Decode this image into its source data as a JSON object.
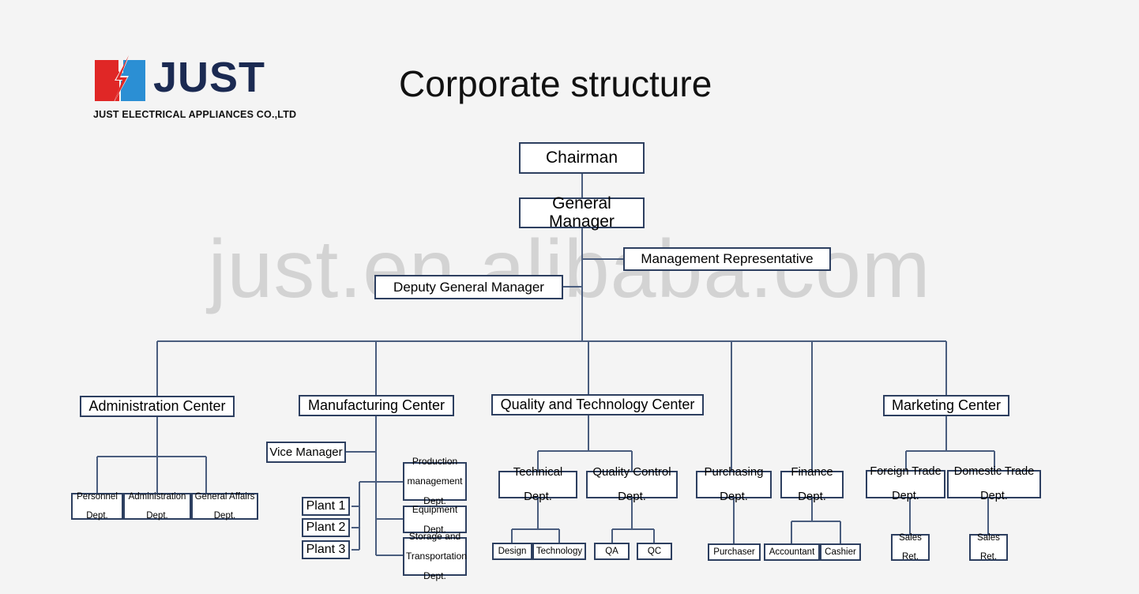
{
  "page": {
    "title": "Corporate structure",
    "background_color": "#f4f4f4",
    "box_border_color": "#2d3f60",
    "watermark": "just.en.alibaba.com"
  },
  "logo": {
    "name": "just-logo",
    "wordmark": "JUST",
    "tagline": "JUST ELECTRICAL APPLIANCES CO.,LTD",
    "red_color": "#e02726",
    "blue_color": "#2b8fd4",
    "word_color": "#1b2a52"
  },
  "chart_data": {
    "type": "diagram",
    "title": "Corporate structure",
    "nodes": {
      "chairman": "Chairman",
      "general_manager": "General Manager",
      "management_representative": "Management Representative",
      "deputy_general_manager": "Deputy General Manager",
      "administration_center": "Administration Center",
      "manufacturing_center": "Manufacturing Center",
      "quality_technology_center": "Quality and Technology Center",
      "marketing_center": "Marketing Center",
      "personnel_dept": "Personnel Dept.",
      "administration_dept": "Administration Dept.",
      "general_affairs_dept": "General Affairs Dept.",
      "vice_manager": "Vice Manager",
      "plant_1": "Plant 1",
      "plant_2": "Plant 2",
      "plant_3": "Plant 3",
      "production_management_dept": "Production management Dept.",
      "equipment_dept": "Equipment Dept.",
      "storage_transportation_dept": "Storage and Transportation Dept.",
      "technical_dept": "Technical Dept.",
      "quality_control_dept": "Quality Control Dept.",
      "design": "Design",
      "technology": "Technology",
      "qa": "QA",
      "qc": "QC",
      "purchasing_dept": "Purchasing Dept.",
      "finance_dept": "Finance Dept.",
      "purchaser": "Purchaser",
      "accountant": "Accountant",
      "cashier": "Cashier",
      "foreign_trade_dept": "Foreign Trade Dept.",
      "domestic_trade_dept": "Domestic Trade Dept.",
      "sales_ret_foreign": "Sales Ret.",
      "sales_ret_domestic": "Sales Ret."
    },
    "node_lines": {
      "production_management_dept": [
        "Production",
        "management",
        "Dept."
      ],
      "equipment_dept": [
        "Equipment",
        "Dept."
      ],
      "storage_transportation_dept": [
        "Storage and",
        "Transportation",
        "Dept."
      ],
      "technical_dept": [
        "Technical",
        "Dept."
      ],
      "quality_control_dept": [
        "Quality Control",
        "Dept."
      ],
      "purchasing_dept": [
        "Purchasing",
        "Dept."
      ],
      "finance_dept": [
        "Finance",
        "Dept."
      ],
      "personnel_dept": [
        "Personnel",
        "Dept."
      ],
      "administration_dept": [
        "Administration",
        "Dept."
      ],
      "general_affairs_dept": [
        "General Affairs",
        "Dept."
      ],
      "foreign_trade_dept": [
        "Foreign Trade",
        "Dept."
      ],
      "domestic_trade_dept": [
        "Domestic Trade",
        "Dept."
      ],
      "sales_ret_foreign": [
        "Sales",
        "Ret."
      ],
      "sales_ret_domestic": [
        "Sales",
        "Ret."
      ]
    },
    "edges": [
      [
        "chairman",
        "general_manager"
      ],
      [
        "general_manager",
        "management_representative"
      ],
      [
        "general_manager",
        "deputy_general_manager"
      ],
      [
        "deputy_general_manager",
        "administration_center"
      ],
      [
        "deputy_general_manager",
        "manufacturing_center"
      ],
      [
        "deputy_general_manager",
        "quality_technology_center"
      ],
      [
        "deputy_general_manager",
        "purchasing_dept"
      ],
      [
        "deputy_general_manager",
        "finance_dept"
      ],
      [
        "deputy_general_manager",
        "marketing_center"
      ],
      [
        "administration_center",
        "personnel_dept"
      ],
      [
        "administration_center",
        "administration_dept"
      ],
      [
        "administration_center",
        "general_affairs_dept"
      ],
      [
        "manufacturing_center",
        "vice_manager"
      ],
      [
        "manufacturing_center",
        "production_management_dept"
      ],
      [
        "manufacturing_center",
        "equipment_dept"
      ],
      [
        "manufacturing_center",
        "storage_transportation_dept"
      ],
      [
        "manufacturing_center",
        "plant_1"
      ],
      [
        "manufacturing_center",
        "plant_2"
      ],
      [
        "manufacturing_center",
        "plant_3"
      ],
      [
        "quality_technology_center",
        "technical_dept"
      ],
      [
        "quality_technology_center",
        "quality_control_dept"
      ],
      [
        "technical_dept",
        "design"
      ],
      [
        "technical_dept",
        "technology"
      ],
      [
        "quality_control_dept",
        "qa"
      ],
      [
        "quality_control_dept",
        "qc"
      ],
      [
        "purchasing_dept",
        "purchaser"
      ],
      [
        "finance_dept",
        "accountant"
      ],
      [
        "finance_dept",
        "cashier"
      ],
      [
        "marketing_center",
        "foreign_trade_dept"
      ],
      [
        "marketing_center",
        "domestic_trade_dept"
      ],
      [
        "foreign_trade_dept",
        "sales_ret_foreign"
      ],
      [
        "domestic_trade_dept",
        "sales_ret_domestic"
      ]
    ]
  }
}
